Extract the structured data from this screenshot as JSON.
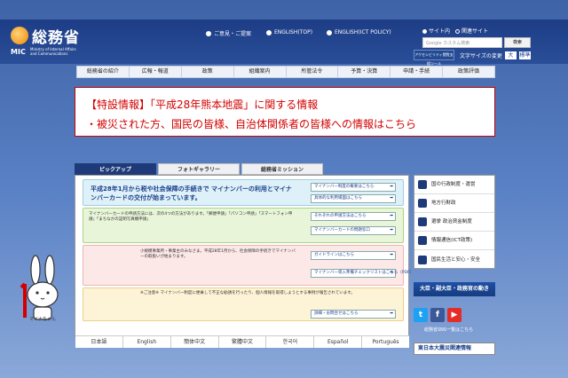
{
  "header": {
    "logo_text": "総務省",
    "logo_mic": "MIC",
    "logo_sub": "Ministry of Internal Affairs and Communications",
    "links": [
      "ご意見・ご提案",
      "ENGLISH(TOP)",
      "ENGLISH(ICT POLICY)"
    ],
    "radio_site": "サイト内",
    "radio_related": "関連サイト",
    "search_placeholder": "Google カスタム検索",
    "search_button": "検索",
    "access_button": "アクセシビリティ閲覧支援ツール",
    "font_size_label": "文字サイズの変更",
    "font_large": "大",
    "font_standard": "標準"
  },
  "nav": [
    "総務省の紹介",
    "広報・報道",
    "政策",
    "組織案内",
    "所管法令",
    "予算・決算",
    "申請・手続",
    "政策評価"
  ],
  "notice": {
    "line1": "【特設情報】「平成28年熊本地震」に関する情報",
    "line2": "・被災された方、国民の皆様、自治体関係者の皆様への情報はこちら"
  },
  "tabs": [
    "ピックアップ",
    "フォトギャラリー",
    "総務省ミッション"
  ],
  "pickup": {
    "box1_title": "平成28年1月から税や社会保障の手続きで マイナンバーの利用とマイナンバーカードの交付が始まっています。",
    "box1_btn1": "マイナンバー制度の概要はこちら",
    "box1_btn2": "具体的な利用場面はこちら",
    "box2_text": "マイナンバーカードの申請方法には、次の4つの方法があります。「郵便申請」「パソコン申請」「スマートフォン申請」「まちなかの証明写真機申請」",
    "box2_btn1": "それぞれの申請方法はこちら",
    "box2_btn2": "マイナンバーカードの問題窓口",
    "box3_text": "小規模事業所・事業主のみなさま。平成28年1月から、社会保障の手続きでマイナンバーの取扱いが始まります。",
    "box3_btn1": "ガイドラインはこちら",
    "box3_btn2": "マイナンバー導入準備チェックリストはこちら（PDF）",
    "box4_text": "※ご注意※ マイナンバー制度に便乗して不正な勧誘を行ったり、個人情報を取得しようとする事例が報告されています。",
    "box4_btn": "詳細・お問合せはこちら",
    "mascot_name": "マイナちゃん"
  },
  "languages": [
    "日本語",
    "English",
    "簡体中文",
    "繁體中文",
    "한국어",
    "Español",
    "Português"
  ],
  "sidebar": {
    "items": [
      "国の行政制度・運営",
      "地方行財政",
      "選挙 政治資金制度",
      "情報通信(ICT政策)",
      "国民生活と安心・安全"
    ],
    "banner1": "大臣・副大臣・政務官の動き",
    "sns_link": "総務省SNS一覧はこちら",
    "banner2": "東日本大震災関連情報"
  }
}
